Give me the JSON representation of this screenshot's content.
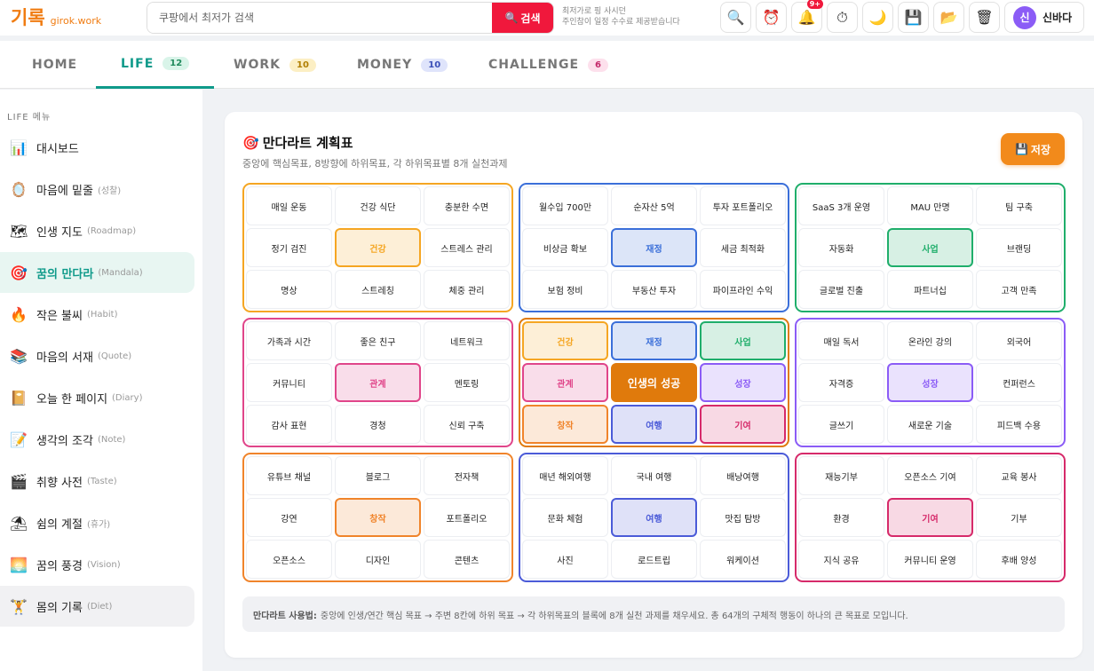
{
  "logo": {
    "main": "기록",
    "sub": "girok.work"
  },
  "search": {
    "placeholder": "쿠팡에서 최저가 검색",
    "button": "검색",
    "icon": "search-icon"
  },
  "ad_note": {
    "line1": "최저가로 핑 사시던",
    "line2": "주인참이 일정 수수료 제공받습니다"
  },
  "header_icons": [
    {
      "name": "search-icon",
      "glyph": "🔍"
    },
    {
      "name": "alarm-clock-icon",
      "glyph": "⏰"
    },
    {
      "name": "bell-icon",
      "glyph": "🔔",
      "badge": "9+"
    },
    {
      "name": "stopwatch-icon",
      "glyph": "⏱"
    },
    {
      "name": "moon-icon",
      "glyph": "🌙"
    },
    {
      "name": "floppy-disk-icon",
      "glyph": "💾"
    },
    {
      "name": "folder-icon",
      "glyph": "📂"
    },
    {
      "name": "trash-icon",
      "glyph": "🗑"
    }
  ],
  "user": {
    "initial": "신",
    "name": "신바다"
  },
  "tabs": [
    {
      "label": "HOME",
      "count": ""
    },
    {
      "label": "LIFE",
      "count": "12",
      "active": true
    },
    {
      "label": "WORK",
      "count": "10"
    },
    {
      "label": "MONEY",
      "count": "10"
    },
    {
      "label": "CHALLENGE",
      "count": "6"
    }
  ],
  "sidebar": {
    "title": "LIFE 메뉴",
    "items": [
      {
        "label": "대시보드",
        "sub": "",
        "icon": "bar-chart-icon",
        "glyph": "📊"
      },
      {
        "label": "마음에 밑줄",
        "sub": "(성찰)",
        "icon": "mirror-icon",
        "glyph": "🪞"
      },
      {
        "label": "인생 지도",
        "sub": "(Roadmap)",
        "icon": "map-icon",
        "glyph": "🗺"
      },
      {
        "label": "꿈의 만다라",
        "sub": "(Mandala)",
        "icon": "target-icon",
        "glyph": "🎯",
        "active": true
      },
      {
        "label": "작은 불씨",
        "sub": "(Habit)",
        "icon": "fire-icon",
        "glyph": "🔥"
      },
      {
        "label": "마음의 서재",
        "sub": "(Quote)",
        "icon": "books-icon",
        "glyph": "📚"
      },
      {
        "label": "오늘 한 페이지",
        "sub": "(Diary)",
        "icon": "diary-icon",
        "glyph": "📔"
      },
      {
        "label": "생각의 조각",
        "sub": "(Note)",
        "icon": "memo-icon",
        "glyph": "📝"
      },
      {
        "label": "취향 사전",
        "sub": "(Taste)",
        "icon": "clapper-icon",
        "glyph": "🎬"
      },
      {
        "label": "쉼의 계절",
        "sub": "(휴가)",
        "icon": "beach-icon",
        "glyph": "⛱"
      },
      {
        "label": "꿈의 풍경",
        "sub": "(Vision)",
        "icon": "sunrise-icon",
        "glyph": "🌅"
      },
      {
        "label": "몸의 기록",
        "sub": "(Diet)",
        "icon": "weightlifter-icon",
        "glyph": "🏋",
        "highlight": true
      }
    ]
  },
  "card": {
    "title": "만다라트 계획표",
    "title_icon": "target-icon",
    "subtitle": "중앙에 핵심목표, 8방향에 하위목표, 각 하위목표별 8개 실천과제",
    "save": "저장"
  },
  "colors": {
    "health": "#f5a623",
    "finance": "#3b6fd9",
    "business": "#1fae6b",
    "relation": "#e0458a",
    "growth": "#8b5cf6",
    "create": "#f0842b",
    "travel": "#4b5bd8",
    "contribute": "#d62a6a",
    "center": "#e07a0c"
  },
  "mandala": [
    {
      "theme": "health",
      "cells": [
        "매일 운동",
        "건강 식단",
        "충분한 수면",
        "정기 검진",
        "건강",
        "스트레스 관리",
        "명상",
        "스트레칭",
        "체중 관리"
      ]
    },
    {
      "theme": "finance",
      "cells": [
        "월수입 700만",
        "순자산 5억",
        "투자 포트폴리오",
        "비상금 확보",
        "재정",
        "세금 최적화",
        "보험 정비",
        "부동산 투자",
        "파이프라인 수익"
      ]
    },
    {
      "theme": "business",
      "cells": [
        "SaaS 3개 운영",
        "MAU 만명",
        "팀 구축",
        "자동화",
        "사업",
        "브랜딩",
        "글로벌 진출",
        "파트너십",
        "고객 만족"
      ]
    },
    {
      "theme": "relation",
      "cells": [
        "가족과 시간",
        "좋은 친구",
        "네트워크",
        "커뮤니티",
        "관계",
        "멘토링",
        "감사 표현",
        "경청",
        "신뢰 구축"
      ]
    },
    {
      "theme": "center",
      "cells": [
        "건강",
        "재정",
        "사업",
        "관계",
        "인생의 성공",
        "성장",
        "창작",
        "여행",
        "기여"
      ]
    },
    {
      "theme": "growth",
      "cells": [
        "매일 독서",
        "온라인 강의",
        "외국어",
        "자격증",
        "성장",
        "컨퍼런스",
        "글쓰기",
        "새로운 기술",
        "피드백 수용"
      ]
    },
    {
      "theme": "create",
      "cells": [
        "유튜브 채널",
        "블로그",
        "전자책",
        "강연",
        "창작",
        "포트폴리오",
        "오픈소스",
        "디자인",
        "콘텐츠"
      ]
    },
    {
      "theme": "travel",
      "cells": [
        "매년 해외여행",
        "국내 여행",
        "배낭여행",
        "문화 체험",
        "여행",
        "맛집 탐방",
        "사진",
        "로드트립",
        "워케이션"
      ]
    },
    {
      "theme": "contribute",
      "cells": [
        "재능기부",
        "오픈소스 기여",
        "교육 봉사",
        "환경",
        "기여",
        "기부",
        "지식 공유",
        "커뮤니티 운영",
        "후배 양성"
      ]
    }
  ],
  "usage": {
    "label": "만다라트 사용법:",
    "text": "중앙에 인생/연간 핵심 목표 → 주변 8칸에 하위 목표 → 각 하위목표의 블록에 8개 실천 과제를 채우세요. 총 64개의 구체적 행동이 하나의 큰 목표로 모입니다."
  }
}
